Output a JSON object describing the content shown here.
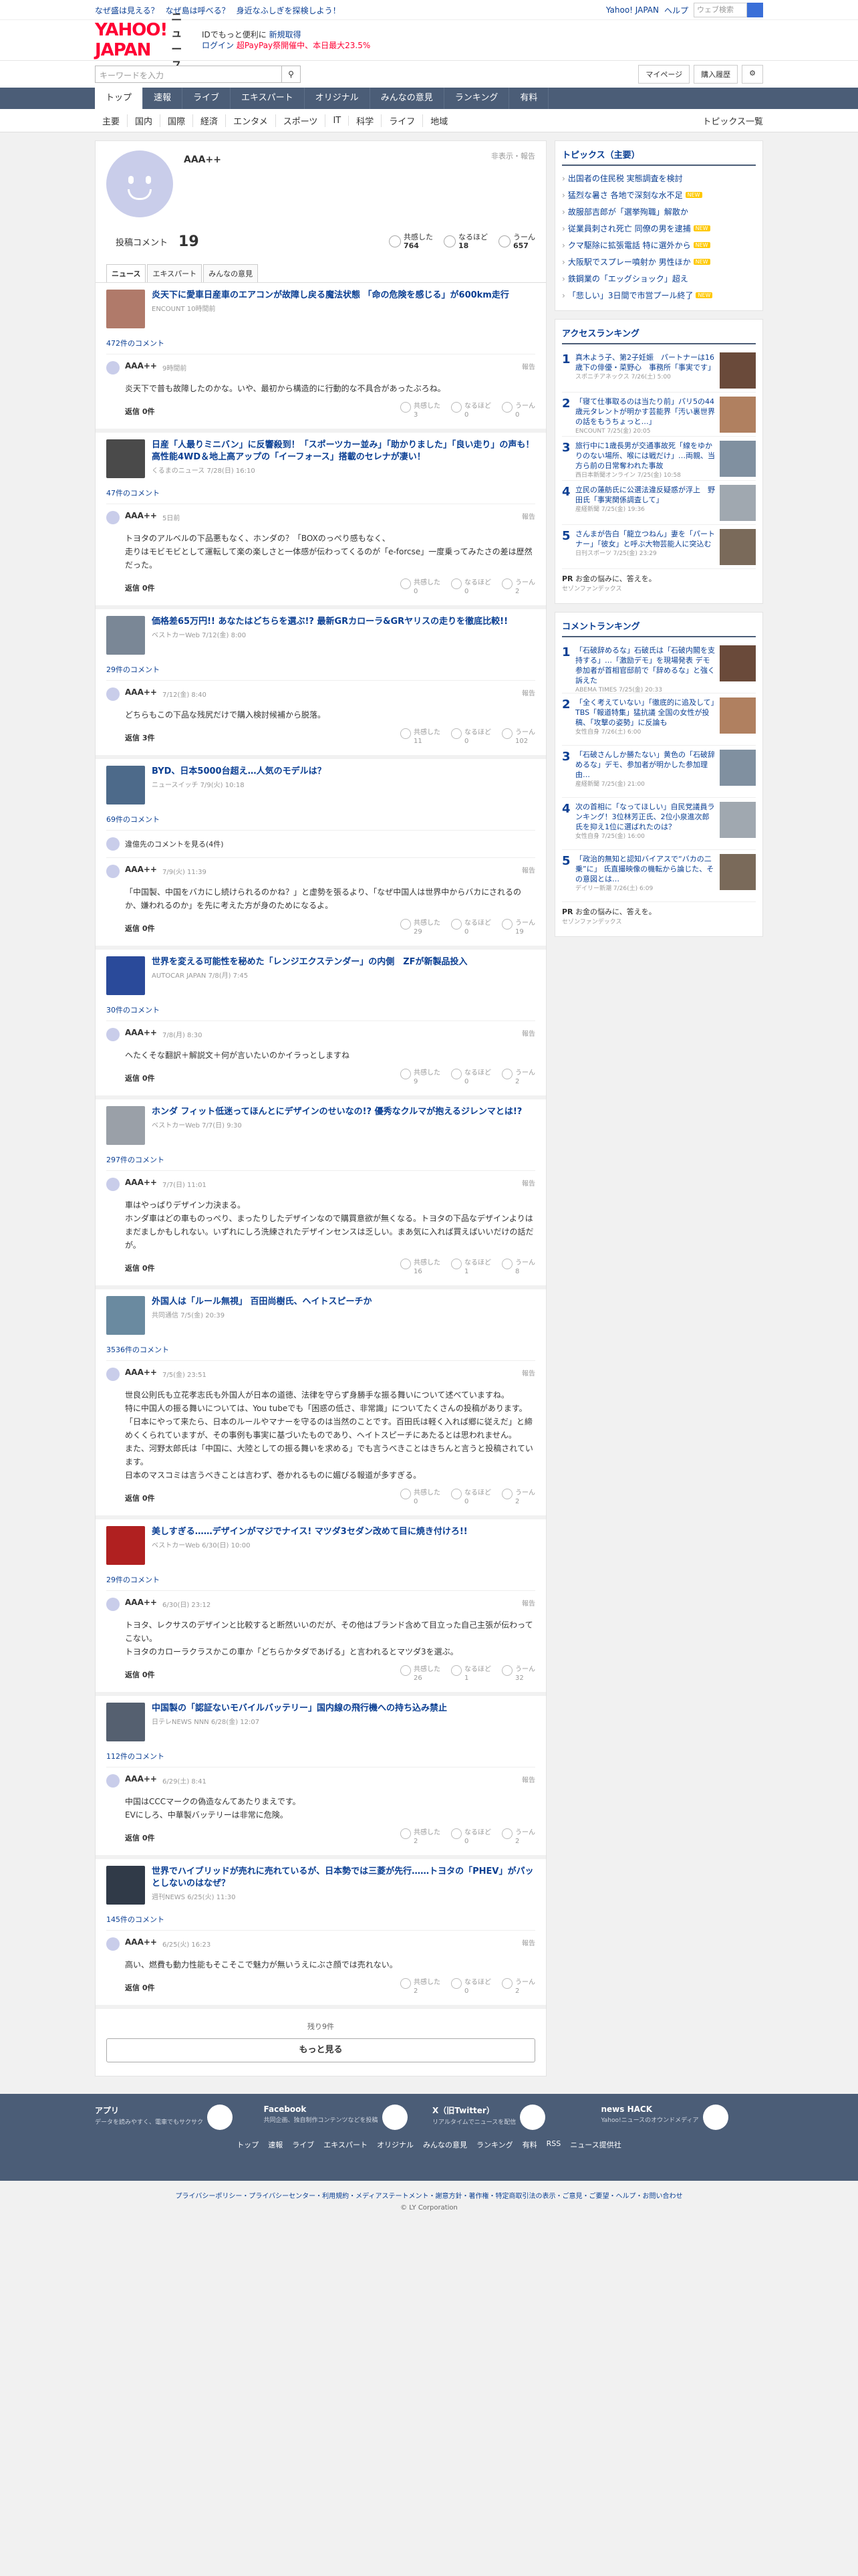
{
  "topbar": {
    "links": [
      "なぜ盛は見える？",
      "なぜ島は呼べる？",
      "身近なふしぎを探検しよう！"
    ],
    "right_links": [
      "Yahoo! JAPAN",
      "ヘルプ"
    ],
    "search_placeholder": "ウェブ検索",
    "search_button": "検索"
  },
  "header": {
    "logo": "YAHOO! JAPAN",
    "logo_sub": "ニュース",
    "msg1": "IDでもっと便利に",
    "msg1_link": "新規取得",
    "msg2_link": "ログイン",
    "msg2_text": "超PayPay祭開催中、本日最大23.5%"
  },
  "tools": {
    "search_placeholder": "キーワードを入力",
    "mypage": "マイページ",
    "history": "購入履歴"
  },
  "nav": [
    "トップ",
    "速報",
    "ライブ",
    "エキスパート",
    "オリジナル",
    "みんなの意見",
    "ランキング",
    "有料"
  ],
  "subnav": [
    "主要",
    "国内",
    "国際",
    "経済",
    "エンタメ",
    "スポーツ",
    "IT",
    "科学",
    "ライフ",
    "地域"
  ],
  "subnav_right": "トピックス一覧",
  "profile": {
    "name": "AAA++",
    "report_link": "非表示・報告",
    "comments_label": "投稿コメント",
    "comments_count": "19",
    "reactions": [
      {
        "label": "共感した",
        "value": "764"
      },
      {
        "label": "なるほど",
        "value": "18"
      },
      {
        "label": "うーん",
        "value": "657"
      }
    ],
    "tabs": [
      "ニュース",
      "エキスパート",
      "みんなの意見"
    ]
  },
  "labels": {
    "reply": "返信 0件",
    "report": "報告",
    "r1": "共感した",
    "r2": "なるほど",
    "r3": "うーん"
  },
  "entries": [
    {
      "title": "炎天下に愛車日産車のエアコンが故障し戻る魔法状態 「命の危険を感じる」が600km走行",
      "src": "ENCOUNT 10時間前",
      "count": "472件のコメント",
      "name": "AAA++",
      "date": "9時間前",
      "text": "炎天下で普も故障したのかな。いや、最初から構造的に行動的な不具合があったぶろね。",
      "reply": "返信 0件",
      "r": [
        "3",
        "0",
        "0"
      ],
      "color": "#b07a6a"
    },
    {
      "title": "日産「人最りミニバン」に反響殺到！「スポーツカー並み」「助かりました」「良い走り」の声も！高性能4WD＆地上高アップの「イーフォース」搭載のセレナが凄い！",
      "src": "くるまのニュース 7/28(日) 16:10",
      "count": "47件のコメント",
      "name": "AAA++",
      "date": "5日前",
      "text": "トヨタのアルベルの下品悪もなく、ホンダの？「BOXのっぺり感もなく、\n走りはモビモビとして運転して楽の楽しさと一体感が伝わってくるのが「e-forcse」一度乗ってみたさの差は歴然だった。",
      "reply": "返信 0件",
      "r": [
        "0",
        "0",
        "2"
      ],
      "color": "#4a4a4a"
    },
    {
      "title": "価格差65万円!! あなたはどちらを選ぶ!? 最新GRカローラ&GRヤリスの走りを徹底比較!!",
      "src": "ベストカーWeb 7/12(金) 8:00",
      "count": "29件のコメント",
      "name": "AAA++",
      "date": "7/12(金) 8:40",
      "text": "どちらもこの下品な残尻だけで購入検討候補から脱落。",
      "reply": "返信 3件",
      "r": [
        "11",
        "0",
        "102"
      ],
      "color": "#7a8796"
    },
    {
      "title": "BYD、日本5000台超え…人気のモデルは？",
      "src": "ニュースイッチ 7/9(火) 10:18",
      "count": "69件のコメント",
      "hidden": "違億先のコメントを見る(4件)",
      "name": "AAA++",
      "date": "7/9(火) 11:39",
      "text": "「中国製、中国をバカにし続けられるのかね？」と虚勢を張るより、「なぜ中国人は世界中からバカにされるのか、嫌われるのか」を先に考えた方が身のためになるよ。",
      "reply": "返信 0件",
      "r": [
        "29",
        "0",
        "19"
      ],
      "color": "#4d6a8a"
    },
    {
      "title": "世界を変える可能性を秘めた「レンジエクステンダー」の内側　ZFが新製品投入",
      "src": "AUTOCAR JAPAN 7/8(月) 7:45",
      "count": "30件のコメント",
      "name": "AAA++",
      "date": "7/8(月) 8:30",
      "text": "ヘたくそな翻訳＋解説文＋何が言いたいのかイラっとしますね",
      "reply": "返信 0件",
      "r": [
        "9",
        "0",
        "2"
      ],
      "color": "#2a4a9a"
    },
    {
      "title": "ホンダ フィット低迷ってほんとにデザインのせいなの!? 優秀なクルマが抱えるジレンマとは!?",
      "src": "ベストカーWeb 7/7(日) 9:30",
      "count": "297件のコメント",
      "name": "AAA++",
      "date": "7/7(日) 11:01",
      "text": "車はやっぱりデザイン力決まる。\nホンダ車はどの車ものっぺり、まったりしたデザインなので購買意欲が無くなる。トヨタの下品なデザインよりはまだましかもしれない。いずれにしろ洗練されたデザインセンスは乏しい。まあ気に入れば買えばいいだけの話だが。",
      "reply": "返信 0件",
      "r": [
        "16",
        "1",
        "8"
      ],
      "color": "#9aa0a8"
    },
    {
      "title": "外国人は「ルール無視」 百田尚樹氏、ヘイトスピーチか",
      "src": "共同通信 7/5(金) 20:39",
      "count": "3536件のコメント",
      "name": "AAA++",
      "date": "7/5(金) 23:51",
      "text": "世良公則氏も立花孝志氏も外国人が日本の道徳、法律を守らず身勝手な振る舞いについて述べていますね。\n特に中国人の振る舞いについては、You tubeでも「困惑の低さ、非常識」についてたくさんの投稿があります。\n「日本にやって来たら、日本のルールやマナーを守るのは当然のことです。百田氏は軽く入れば郷に従えだ」と締めくくられていますが、その事例も事実に基づいたものであり、ヘイトスピーチにあたるとは思われません。\nまた、河野太郎氏は「中国に、大陸としての振る舞いを求める」でも言うべきことはきちんと言うと投稿されています。\n日本のマスコミは言うべきことは言わず、巻かれるものに媚びる報道が多すぎる。",
      "reply": "返信 0件",
      "r": [
        "0",
        "0",
        "2"
      ],
      "color": "#6a8aa0"
    },
    {
      "title": "美しすぎる……デザインがマジでナイス! マツダ3セダン改めて目に焼き付けろ!!",
      "src": "ベストカーWeb 6/30(日) 10:00",
      "count": "29件のコメント",
      "name": "AAA++",
      "date": "6/30(日) 23:12",
      "text": "トヨタ、レクサスのデザインと比較すると断然いいのだが、その他はブランド含めて目立った自己主張が伝わってこない。\nトヨタのカローラクラスかこの車か「どちらかタダであげる」と言われるとマツダ3を選ぶ。",
      "reply": "返信 0件",
      "r": [
        "26",
        "1",
        "32"
      ],
      "color": "#b02020"
    },
    {
      "title": "中国製の「認証ないモバイルバッテリー」国内線の飛行機への持ち込み禁止",
      "src": "日テレNEWS NNN 6/28(金) 12:07",
      "count": "112件のコメント",
      "name": "AAA++",
      "date": "6/29(土) 8:41",
      "text": "中国はCCCマークの偽造なんてあたりまえです。\nEVにしろ、中華製バッテリーは非常に危険。",
      "reply": "返信 0件",
      "r": [
        "2",
        "0",
        "2"
      ],
      "color": "#556070"
    },
    {
      "title": "世界でハイブリッドが売れに売れているが、日本勢では三菱が先行……トヨタの「PHEV」がパッとしないのはなぜ？",
      "src": "週刊NEWS 6/25(火) 11:30",
      "count": "145件のコメント",
      "name": "AAA++",
      "date": "6/25(火) 16:23",
      "text": "高い、燃費も動力性能もそこそこで魅力が無いうえにぶさ顔では売れない。",
      "reply": "返信 0件",
      "r": [
        "2",
        "0",
        "2"
      ],
      "color": "#303a48"
    }
  ],
  "more": {
    "rest": "残り9件",
    "button": "もっと見る"
  },
  "side": {
    "topics_title": "トピックス（主要）",
    "topics": [
      {
        "t": "出国者の住民税 実態調査を検討",
        "n": ""
      },
      {
        "t": "猛烈な暑さ 各地で深刻な水不足",
        "n": "NEW"
      },
      {
        "t": "故服部吉郎が「選挙殉職」解散か",
        "n": ""
      },
      {
        "t": "従業員刺され死亡 同僚の男を逮捕",
        "n": "NEW"
      },
      {
        "t": "クマ駆除に拡張電話 特に選外から",
        "n": "NEW"
      },
      {
        "t": "大阪駅でスプレー噴射か 男性ほか",
        "n": "NEW"
      },
      {
        "t": "鉄鋼業の「エッグショック」超え",
        "n": ""
      },
      {
        "t": "「悲しい」3日間で市営プール終了",
        "n": "NEW"
      }
    ],
    "access_title": "アクセスランキング",
    "access": [
      {
        "t": "真木よう子、第2子妊娠　パートナーは16歳下の俳優・菜野心　事務所「事実です」",
        "s": "スポニチアネックス 7/26(土) 5:00"
      },
      {
        "t": "「寝て仕事取るのは当たり前」パリ5の44歳元タレントが明かす芸能界「汚い裏世界の話をもうちょっと…」",
        "s": "ENCOUNT 7/25(金) 20:05"
      },
      {
        "t": "旅行中に1歳長男が交通事故死「線をゆかりのない場所、喉には戦だけ」…両親、当方ら前の日常奪われた事故",
        "s": "西日本新聞オンライン 7/25(金) 10:58"
      },
      {
        "t": "立民の蓮舫氏に公選法違反疑惑が浮上　野田氏「事実関係調査して」",
        "s": "産経新聞 7/25(金) 19:36"
      },
      {
        "t": "さんまが告白「龍立つねん」妻を「パートナー」「彼女」と呼ぶ大物芸能人に突込む",
        "s": "日刊スポーツ 7/25(金) 23:29"
      }
    ],
    "pr_title": "お金の悩みに、答えを。",
    "pr_src": "セゾンファンデックス",
    "pr_label": "PR",
    "comment_title": "コメントランキング",
    "comments": [
      {
        "t": "「石破辞めるな」石破氏は「石破内閣を支持する」…「激励デモ」を現場発表 デモ参加者が首相官邸前で「辞めるな」と強く訴えた",
        "s": "ABEMA TIMES 7/25(金) 20:33"
      },
      {
        "t": "「全く考えていない」「徹底的に追及して」TBS「報道特集」猛抗議 全国の女性が投稿、「攻撃の姿勢」に反論も",
        "s": "女性自身 7/26(土) 6:00"
      },
      {
        "t": "「石破さんしか勝たない」黄色の「石破辞めるな」デモ、参加者が明かした参加理由…",
        "s": "産経新聞 7/25(金) 21:00"
      },
      {
        "t": "次の首相に「なってほしい」自民党議員ランキング！3位林芳正氏、2位小泉進次郎氏を抑え1位に選ばれたのは？",
        "s": "女性自身 7/25(金) 16:00"
      },
      {
        "t": "「政治的無知と認知バイアスで“バカの二乗”に」 氏直撮映像の機転から論じた、その意図とは…",
        "s": "デイリー新潮 7/26(土) 6:09"
      }
    ]
  },
  "footer": {
    "items": [
      {
        "t": "アプリ",
        "d": "データを読みやすく、電車でもサクサク",
        "i": "Y"
      },
      {
        "t": "Facebook",
        "d": "共同企画、独自制作コンテンツなどを投稿",
        "i": "f"
      },
      {
        "t": "X（旧Twitter）",
        "d": "リアルタイムでニュースを配信",
        "i": "X"
      },
      {
        "t": "news HACK",
        "d": "Yahoo!ニュースのオウンドメディア",
        "i": "H"
      }
    ],
    "links": [
      "トップ",
      "速報",
      "ライブ",
      "エキスパート",
      "オリジナル",
      "みんなの意見",
      "ランキング",
      "有料",
      "RSS",
      "ニュース提供社"
    ],
    "legal": "プライバシーポリシー・プライバシーセンター・利用規約・メディアステートメント・謝意方針・著作権・特定商取引法の表示・ご意見・ご要望・ヘルプ・お問い合わせ",
    "copy": "© LY Corporation"
  }
}
